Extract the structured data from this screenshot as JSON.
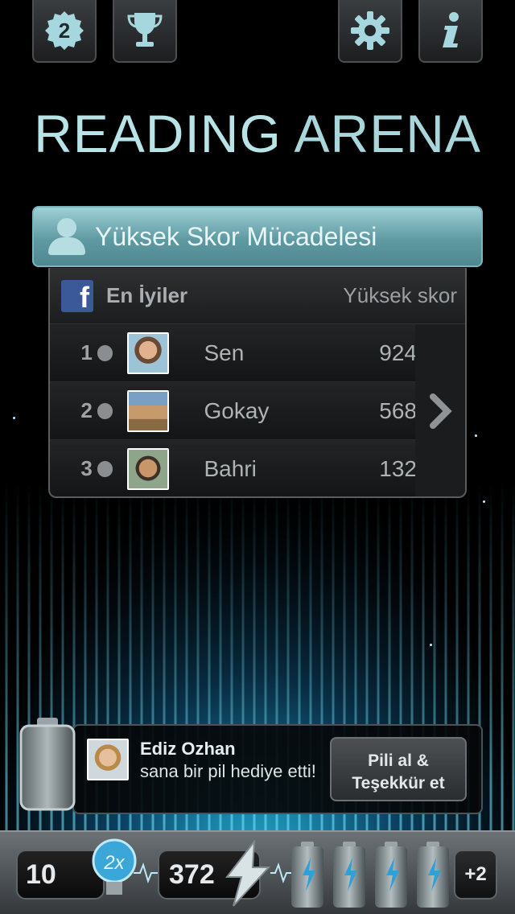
{
  "top_bar": {
    "badge_number": "2",
    "icons": [
      "badge-icon",
      "trophy-icon",
      "gear-icon",
      "info-icon"
    ]
  },
  "title": {
    "bold": "READING",
    "light": " ARENA"
  },
  "high_score": {
    "header": "Yüksek Skor Mücadelesi",
    "board_label": "En İyiler",
    "column_label": "Yüksek skor",
    "rows": [
      {
        "rank": "1",
        "name": "Sen",
        "score": "924"
      },
      {
        "rank": "2",
        "name": "Gokay",
        "score": "568"
      },
      {
        "rank": "3",
        "name": "Bahri",
        "score": "132"
      }
    ]
  },
  "gift_notification": {
    "sender": "Ediz Ozhan",
    "message": "sana bir pil hediye etti!",
    "button_line1": "Pili al &",
    "button_line2": "Teşekkür et"
  },
  "bottom_bar": {
    "count": "10",
    "multiplier": "2x",
    "energy": "372",
    "extra_batteries": "+2",
    "batteries": 4
  },
  "colors": {
    "accent": "#b8e4e8",
    "glow": "#28c8f0",
    "facebook": "#3b5998"
  }
}
